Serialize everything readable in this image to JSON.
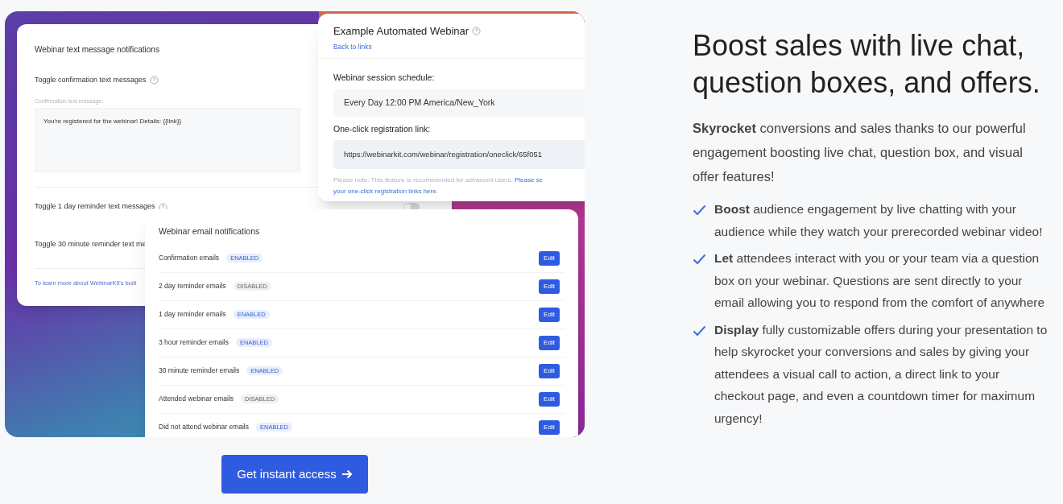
{
  "text_card": {
    "title": "Webinar text message notifications",
    "toggles": [
      {
        "label": "Toggle confirmation text messages",
        "kind": "message",
        "field_label": "Confirmation text message:",
        "value": "You're registered for the webinar! Details: {{link}}"
      },
      {
        "label": "Toggle 1 day reminder text messages",
        "kind": "switch",
        "on": false
      },
      {
        "label": "Toggle 30 minute reminder text me",
        "kind": "plain"
      }
    ],
    "footer_link": "To learn more about WebinarKit's built"
  },
  "webinar_card": {
    "title": "Example Automated Webinar",
    "back_link": "Back to links",
    "schedule_label": "Webinar session schedule:",
    "schedule_value": "Every Day 12:00 PM America/New_York",
    "link_label": "One-click registration link:",
    "link_value": "https://webinarkit.com/webinar/registration/oneclick/65f051",
    "note": "Please note: This feature is recommended for advanced users.",
    "note_link_1": "Please se",
    "note_link_2": "your one-click registration links here."
  },
  "email_card": {
    "title": "Webinar email notifications",
    "rows": [
      {
        "label": "Confirmation emails",
        "status": "ENABLED",
        "enabled": true,
        "button": "Edit"
      },
      {
        "label": "2 day reminder emails",
        "status": "DISABLED",
        "enabled": false,
        "button": "Edit"
      },
      {
        "label": "1 day reminder emails",
        "status": "ENABLED",
        "enabled": true,
        "button": "Edit"
      },
      {
        "label": "3 hour reminder emails",
        "status": "ENABLED",
        "enabled": true,
        "button": "Edit"
      },
      {
        "label": "30 minute reminder emails",
        "status": "ENABLED",
        "enabled": true,
        "button": "Edit"
      },
      {
        "label": "Attended webinar emails",
        "status": "DISABLED",
        "enabled": false,
        "button": "Edit"
      },
      {
        "label": "Did not attend webinar emails",
        "status": "ENABLED",
        "enabled": true,
        "button": "Edit"
      }
    ]
  },
  "cta": "Get instant access",
  "heading": "Boost sales with live chat, question boxes, and offers.",
  "intro": "**Skyrocket** conversions and sales thanks to our powerful engagement boosting live chat, question box, and visual offer features!",
  "features": [
    "**Boost** audience engagement by live chatting with your audience while they watch your prerecorded webinar video!",
    "**Let** attendees interact with you or your team via a question box on your webinar. Questions are sent directly to your email allowing you to respond from the comfort of anywhere",
    "**Display** fully customizable offers during your presentation to help skyrocket your conversions and sales by giving your attendees a visual call to action, a direct link to your checkout page, and even a countdown timer for maximum urgency!"
  ]
}
